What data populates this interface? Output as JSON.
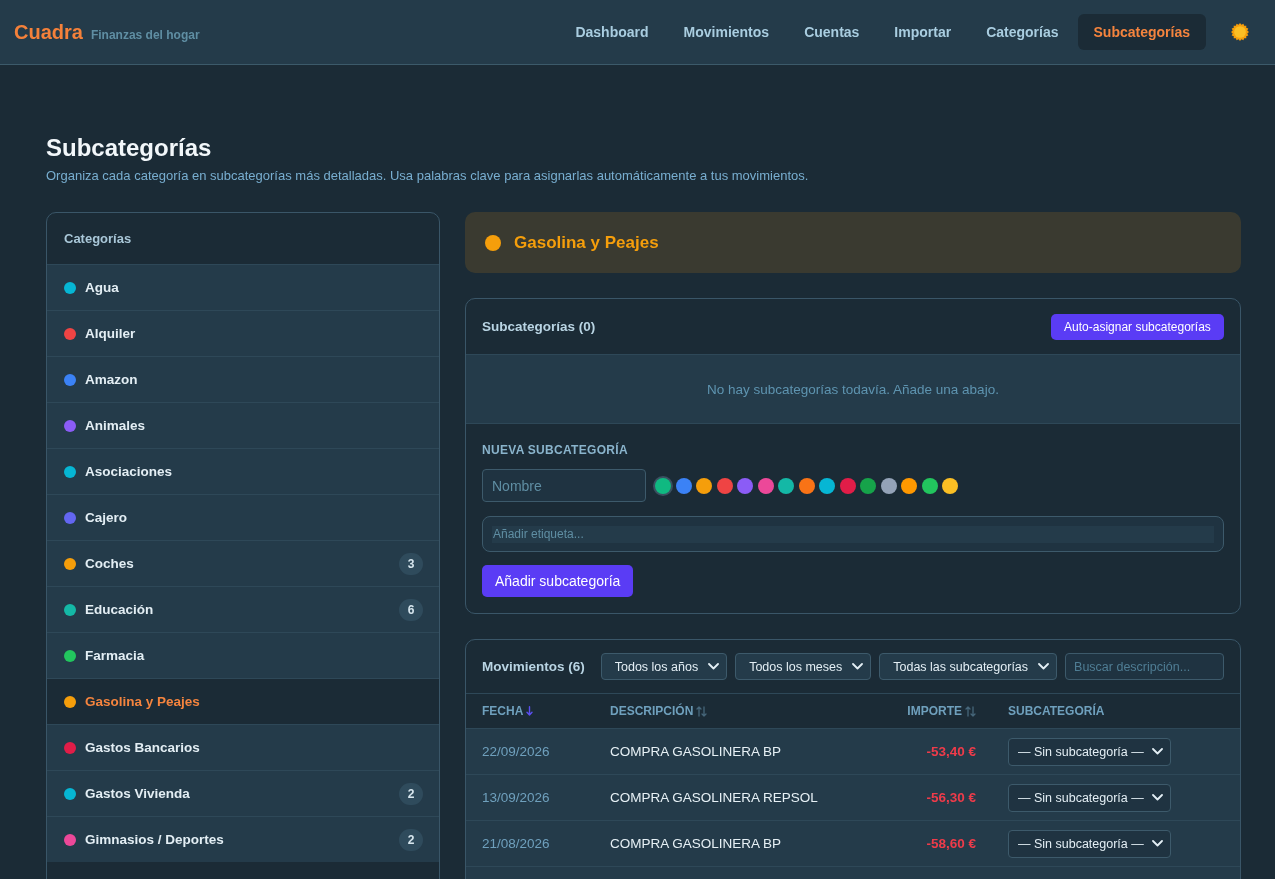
{
  "header": {
    "logo": "Cuadra",
    "tagline": "Finanzas del hogar",
    "nav": [
      {
        "label": "Dashboard",
        "selected": false
      },
      {
        "label": "Movimientos",
        "selected": false
      },
      {
        "label": "Cuentas",
        "selected": false
      },
      {
        "label": "Importar",
        "selected": false
      },
      {
        "label": "Categorías",
        "selected": false
      },
      {
        "label": "Subcategorías",
        "selected": true
      }
    ]
  },
  "page": {
    "title": "Subcategorías",
    "description": "Organiza cada categoría en subcategorías más detalladas. Usa palabras clave para asignarlas automáticamente a tus movimientos."
  },
  "categories_panel": {
    "title": "Categorías",
    "items": [
      {
        "name": "Agua",
        "color": "#06b6d4",
        "selected": false
      },
      {
        "name": "Alquiler",
        "color": "#ef4444",
        "selected": false
      },
      {
        "name": "Amazon",
        "color": "#3b82f6",
        "selected": false
      },
      {
        "name": "Animales",
        "color": "#8b5cf6",
        "selected": false
      },
      {
        "name": "Asociaciones",
        "color": "#06b6d4",
        "selected": false
      },
      {
        "name": "Cajero",
        "color": "#6366f1",
        "selected": false
      },
      {
        "name": "Coches",
        "color": "#f59e0b",
        "selected": false,
        "count": "3"
      },
      {
        "name": "Educación",
        "color": "#14b8a6",
        "selected": false,
        "count": "6"
      },
      {
        "name": "Farmacia",
        "color": "#22c55e",
        "selected": false
      },
      {
        "name": "Gasolina y Peajes",
        "color": "#f59e0b",
        "selected": true
      },
      {
        "name": "Gastos Bancarios",
        "color": "#e11d48",
        "selected": false
      },
      {
        "name": "Gastos Vivienda",
        "color": "#06b6d4",
        "selected": false,
        "count": "2"
      },
      {
        "name": "Gimnasios / Deportes",
        "color": "#ec4899",
        "selected": false,
        "count": "2"
      }
    ]
  },
  "selected_category": {
    "name": "Gasolina y Peajes",
    "color": "#f59e0b"
  },
  "subcategories_card": {
    "title": "Subcategorías (0)",
    "auto_button": "Auto-asignar subcategorías",
    "empty_message": "No hay subcategorías todavía. Añade una abajo."
  },
  "new_subcategory": {
    "heading": "NUEVA SUBCATEGORÍA",
    "name_placeholder": "Nombre",
    "colors": [
      {
        "color": "#10b981",
        "selected": true
      },
      {
        "color": "#3b82f6",
        "selected": false
      },
      {
        "color": "#f59e0b",
        "selected": false
      },
      {
        "color": "#ef4444",
        "selected": false
      },
      {
        "color": "#8b5cf6",
        "selected": false
      },
      {
        "color": "#ec4899",
        "selected": false
      },
      {
        "color": "#14b8a6",
        "selected": false
      },
      {
        "color": "#f97316",
        "selected": false
      },
      {
        "color": "#06b6d4",
        "selected": false
      },
      {
        "color": "#e11d48",
        "selected": false
      },
      {
        "color": "#16a34a",
        "selected": false
      },
      {
        "color": "#94a3b8",
        "selected": false
      },
      {
        "color": "#ff9800",
        "selected": false
      },
      {
        "color": "#22c55e",
        "selected": false
      },
      {
        "color": "#fbbf24",
        "selected": false
      }
    ],
    "tag_placeholder": "Añadir etiqueta...",
    "submit": "Añadir subcategoría"
  },
  "movements": {
    "title": "Movimientos (6)",
    "filters": [
      "Todos los años",
      "Todos los meses",
      "Todas las subcategorías"
    ],
    "search_placeholder": "Buscar descripción...",
    "columns": [
      {
        "label": "FECHA",
        "sortable": true,
        "sorted": true
      },
      {
        "label": "DESCRIPCIÓN",
        "sortable": true,
        "sorted": false
      },
      {
        "label": "IMPORTE",
        "sortable": true,
        "sorted": false,
        "kind": "amount"
      },
      {
        "label": "SUBCATEGORÍA",
        "sortable": false
      }
    ],
    "rows": [
      {
        "date": "22/09/2026",
        "description": "COMPRA GASOLINERA BP",
        "amount": "-53,40 €",
        "subcategory": "— Sin subcategoría —"
      },
      {
        "date": "13/09/2026",
        "description": "COMPRA GASOLINERA REPSOL",
        "amount": "-56,30 €",
        "subcategory": "— Sin subcategoría —"
      },
      {
        "date": "21/08/2026",
        "description": "COMPRA GASOLINERA BP",
        "amount": "-58,60 €",
        "subcategory": "— Sin subcategoría —"
      }
    ]
  }
}
